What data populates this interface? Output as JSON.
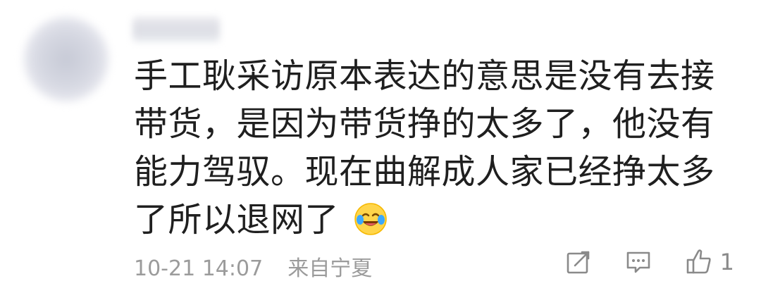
{
  "comment": {
    "text": "手工耿采访原本表达的意思是没有去接带货，是因为带货挣的太多了，他没有能力驾驭。现在曲解成人家已经挣太多了所以退网了",
    "emoji_icon": "crying-laughing-emoji-icon"
  },
  "meta": {
    "timestamp": "10-21 14:07",
    "location": "来自宁夏"
  },
  "actions": {
    "share_icon": "share-icon",
    "comment_icon": "comment-icon",
    "like_icon": "thumbs-up-icon",
    "like_count": "1"
  }
}
